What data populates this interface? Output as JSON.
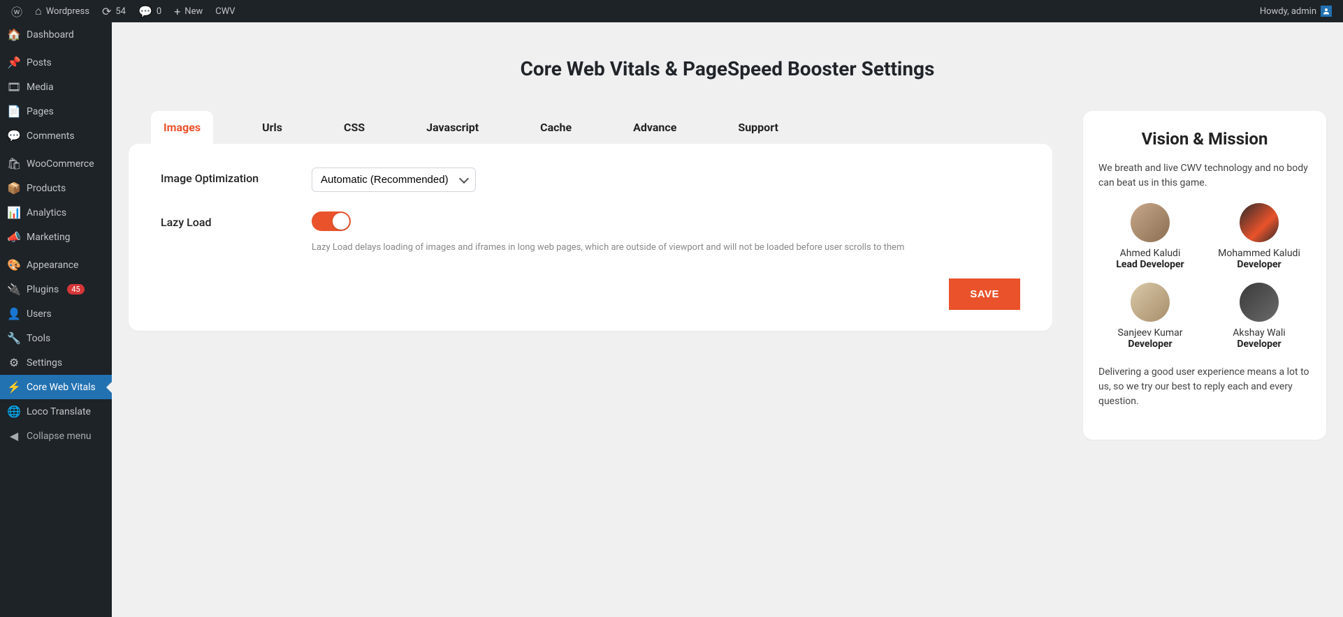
{
  "adminbar": {
    "site_name": "Wordpress",
    "updates_count": "54",
    "comments_count": "0",
    "new_label": "New",
    "extra_label": "CWV",
    "howdy": "Howdy, admin"
  },
  "sidebar": {
    "items": [
      {
        "label": "Dashboard",
        "icon": "🏠"
      },
      {
        "label": "Posts",
        "icon": "📌"
      },
      {
        "label": "Media",
        "icon": "🎞"
      },
      {
        "label": "Pages",
        "icon": "📄"
      },
      {
        "label": "Comments",
        "icon": "💬"
      },
      {
        "label": "WooCommerce",
        "icon": "🛍"
      },
      {
        "label": "Products",
        "icon": "📦"
      },
      {
        "label": "Analytics",
        "icon": "📊"
      },
      {
        "label": "Marketing",
        "icon": "📣"
      },
      {
        "label": "Appearance",
        "icon": "🎨"
      },
      {
        "label": "Plugins",
        "icon": "🔌",
        "badge": "45"
      },
      {
        "label": "Users",
        "icon": "👤"
      },
      {
        "label": "Tools",
        "icon": "🔧"
      },
      {
        "label": "Settings",
        "icon": "⚙"
      },
      {
        "label": "Core Web Vitals",
        "icon": "⚡",
        "current": true
      },
      {
        "label": "Loco Translate",
        "icon": "🌐"
      }
    ],
    "collapse_label": "Collapse menu"
  },
  "page": {
    "title": "Core Web Vitals & PageSpeed Booster Settings"
  },
  "tabs": [
    "Images",
    "Urls",
    "CSS",
    "Javascript",
    "Cache",
    "Advance",
    "Support"
  ],
  "fields": {
    "image_opt_label": "Image Optimization",
    "image_opt_value": "Automatic (Recommended)",
    "lazy_load_label": "Lazy Load",
    "lazy_load_help": "Lazy Load delays loading of images and iframes in long web pages, which are outside of viewport and will not be loaded before user scrolls to them",
    "save_label": "SAVE"
  },
  "aside": {
    "title": "Vision & Mission",
    "intro": "We breath and live CWV technology and no body can beat us in this game.",
    "team": [
      {
        "name": "Ahmed Kaludi",
        "role": "Lead Developer"
      },
      {
        "name": "Mohammed Kaludi",
        "role": "Developer"
      },
      {
        "name": "Sanjeev Kumar",
        "role": "Developer"
      },
      {
        "name": "Akshay Wali",
        "role": "Developer"
      }
    ],
    "outro": "Delivering a good user experience means a lot to us, so we try our best to reply each and every question."
  }
}
